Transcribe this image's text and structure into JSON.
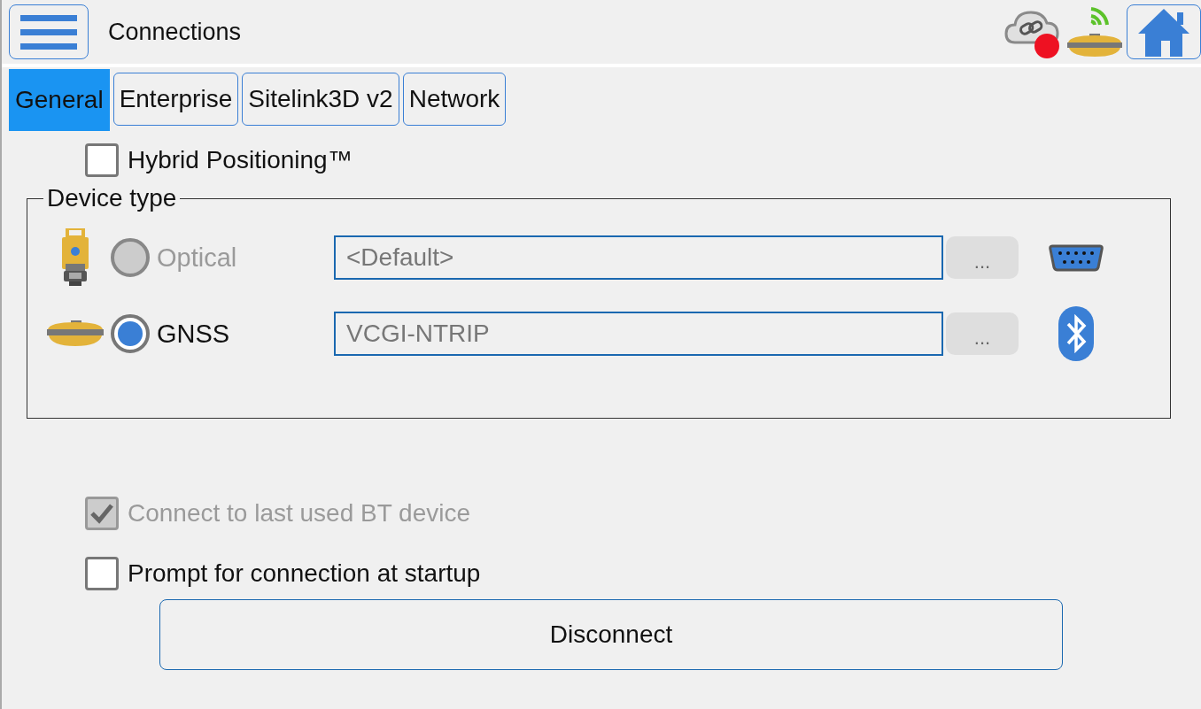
{
  "header": {
    "title": "Connections"
  },
  "tabs": [
    {
      "label": "General",
      "selected": true
    },
    {
      "label": "Enterprise",
      "selected": false
    },
    {
      "label": "Sitelink3D v2",
      "selected": false
    },
    {
      "label": "Network",
      "selected": false
    }
  ],
  "hybrid": {
    "label": "Hybrid Positioning™",
    "checked": false
  },
  "device_type": {
    "title": "Device type",
    "devices": [
      {
        "kind": "optical",
        "label": "Optical",
        "selected": false,
        "disabled": true,
        "value": "<Default>",
        "browse": "...",
        "connection": {
          "kind": "serial"
        }
      },
      {
        "kind": "gnss",
        "label": "GNSS",
        "selected": true,
        "disabled": false,
        "value": "VCGI-NTRIP",
        "browse": "...",
        "connection": {
          "kind": "bluetooth"
        }
      }
    ]
  },
  "options": [
    {
      "label": "Connect to last used BT device",
      "checked": true,
      "disabled": true
    },
    {
      "label": "Prompt for connection at startup",
      "checked": false,
      "disabled": false
    }
  ],
  "disconnect": "Disconnect"
}
